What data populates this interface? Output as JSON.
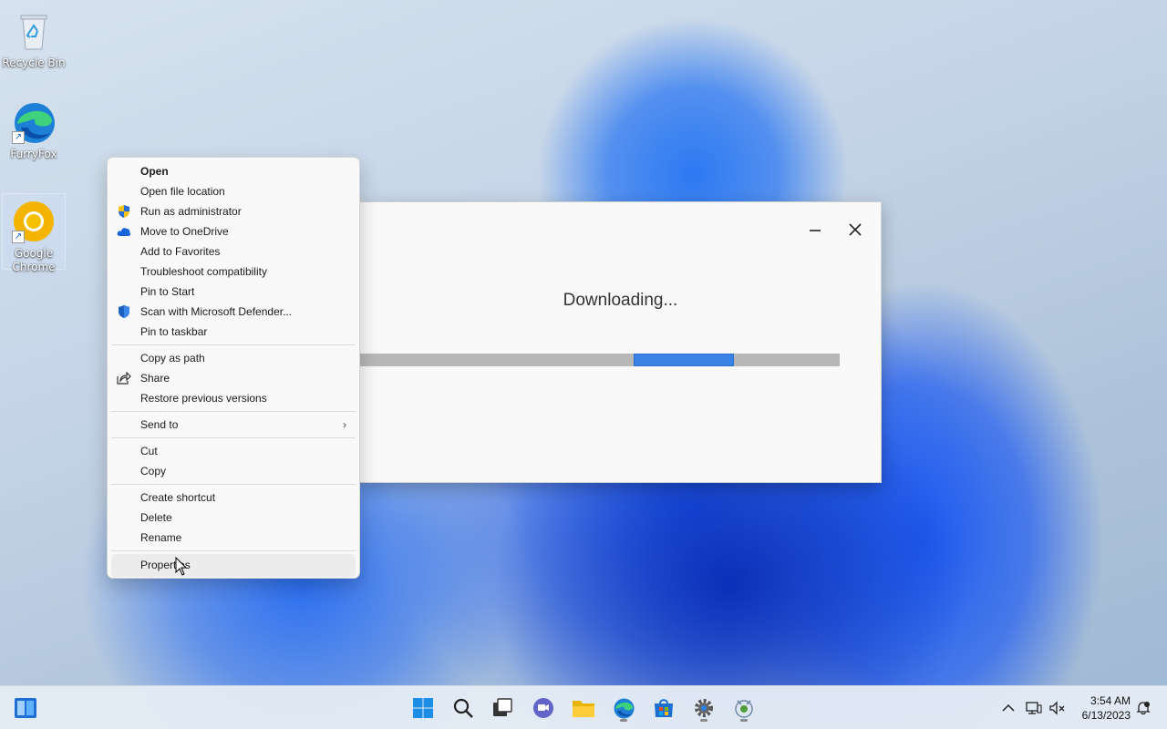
{
  "desktop": {
    "icons": [
      {
        "label": "Recycle Bin"
      },
      {
        "label": "FurryFox"
      },
      {
        "label": "Google Chrome"
      }
    ]
  },
  "download_window": {
    "status_text": "Downloading...",
    "progress_segment_start": 0.57,
    "progress_segment_end": 0.78
  },
  "context_menu": {
    "items": [
      {
        "label": "Open"
      },
      {
        "label": "Open file location"
      },
      {
        "label": "Run as administrator",
        "icon": "uac-shield-icon"
      },
      {
        "label": "Move to OneDrive",
        "icon": "onedrive-cloud-icon"
      },
      {
        "label": "Add to Favorites"
      },
      {
        "label": "Troubleshoot compatibility"
      },
      {
        "label": "Pin to Start"
      },
      {
        "label": "Scan with Microsoft Defender...",
        "icon": "defender-shield-icon"
      },
      {
        "label": "Pin to taskbar"
      },
      {
        "label": "Copy as path"
      },
      {
        "label": "Share",
        "icon": "share-icon"
      },
      {
        "label": "Restore previous versions"
      },
      {
        "label": "Send to"
      },
      {
        "label": "Cut"
      },
      {
        "label": "Copy"
      },
      {
        "label": "Create shortcut"
      },
      {
        "label": "Delete"
      },
      {
        "label": "Rename"
      },
      {
        "label": "Properties"
      }
    ]
  },
  "taskbar": {
    "clock_time": "3:54 AM",
    "clock_date": "6/13/2023"
  },
  "colors": {
    "accent": "#3b82e6",
    "progress_track": "#b8b8b8"
  }
}
